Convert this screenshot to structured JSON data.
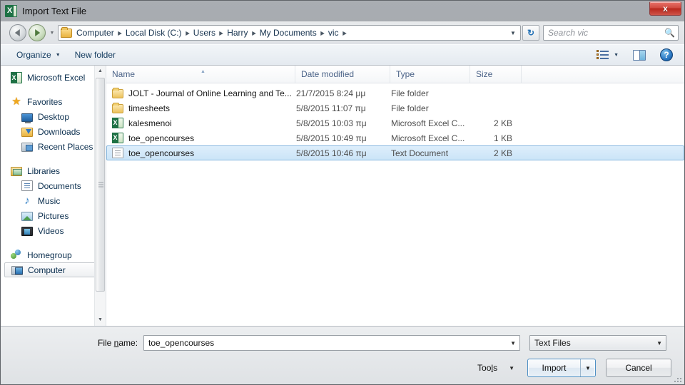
{
  "window": {
    "title": "Import Text File",
    "app_icon": "excel-icon",
    "close_label": "x"
  },
  "nav": {
    "back_label": "Back",
    "forward_label": "Forward",
    "recent_label": "Recent pages",
    "refresh_label": "↻",
    "breadcrumbs": [
      "Computer",
      "Local Disk (C:)",
      "Users",
      "Harry",
      "My Documents",
      "vic"
    ],
    "separator": "▶"
  },
  "search": {
    "placeholder": "Search vic",
    "icon": "search-icon"
  },
  "toolbar": {
    "organize_label": "Organize",
    "new_folder_label": "New folder",
    "caret": "▼",
    "view_icon": "list-view-icon",
    "preview_icon": "preview-pane-icon",
    "help_label": "?"
  },
  "sidebar": {
    "items": [
      {
        "label": "Microsoft Excel",
        "icon": "excel-icon",
        "indent": false,
        "gap": false,
        "selected": false
      },
      {
        "label": "Favorites",
        "icon": "star-icon",
        "indent": false,
        "gap": true,
        "selected": false
      },
      {
        "label": "Desktop",
        "icon": "desktop-icon",
        "indent": true,
        "gap": false,
        "selected": false
      },
      {
        "label": "Downloads",
        "icon": "downloads-icon",
        "indent": true,
        "gap": false,
        "selected": false
      },
      {
        "label": "Recent Places",
        "icon": "recent-places-icon",
        "indent": true,
        "gap": false,
        "selected": false
      },
      {
        "label": "Libraries",
        "icon": "libraries-icon",
        "indent": false,
        "gap": true,
        "selected": false
      },
      {
        "label": "Documents",
        "icon": "documents-icon",
        "indent": true,
        "gap": false,
        "selected": false
      },
      {
        "label": "Music",
        "icon": "music-icon",
        "indent": true,
        "gap": false,
        "selected": false
      },
      {
        "label": "Pictures",
        "icon": "pictures-icon",
        "indent": true,
        "gap": false,
        "selected": false
      },
      {
        "label": "Videos",
        "icon": "videos-icon",
        "indent": true,
        "gap": false,
        "selected": false
      },
      {
        "label": "Homegroup",
        "icon": "homegroup-icon",
        "indent": false,
        "gap": true,
        "selected": false
      },
      {
        "label": "Computer",
        "icon": "computer-icon",
        "indent": false,
        "gap": true,
        "selected": true
      }
    ]
  },
  "filelist": {
    "columns": [
      "Name",
      "Date modified",
      "Type",
      "Size"
    ],
    "sorted_column": "Name",
    "sort_direction": "ascending",
    "rows": [
      {
        "name": "JOLT - Journal of Online Learning and Te...",
        "date": "21/7/2015 8:24 μμ",
        "type": "File folder",
        "size": "",
        "icon": "folder-icon",
        "selected": false
      },
      {
        "name": "timesheets",
        "date": "5/8/2015 11:07 πμ",
        "type": "File folder",
        "size": "",
        "icon": "folder-icon",
        "selected": false
      },
      {
        "name": "kalesmenoi",
        "date": "5/8/2015 10:03 πμ",
        "type": "Microsoft Excel C...",
        "size": "2 KB",
        "icon": "excel-csv-icon",
        "selected": false
      },
      {
        "name": "toe_opencourses",
        "date": "5/8/2015 10:49 πμ",
        "type": "Microsoft Excel C...",
        "size": "1 KB",
        "icon": "excel-csv-icon",
        "selected": false
      },
      {
        "name": "toe_opencourses",
        "date": "5/8/2015 10:46 πμ",
        "type": "Text Document",
        "size": "2 KB",
        "icon": "text-document-icon",
        "selected": true
      }
    ]
  },
  "footer": {
    "filename_label_pre": "File ",
    "filename_label_accel": "n",
    "filename_label_post": "ame:",
    "filename_value": "toe_opencourses",
    "filetype_value": "Text Files",
    "tools_label_pre": "Too",
    "tools_label_accel": "l",
    "tools_label_post": "s",
    "import_label": "Import",
    "cancel_label": "Cancel",
    "caret": "▼"
  },
  "colors": {
    "accent": "#4f90c4",
    "selection": "#cbe4f8",
    "close_button": "#c0392b",
    "excel_green": "#1e7145"
  }
}
